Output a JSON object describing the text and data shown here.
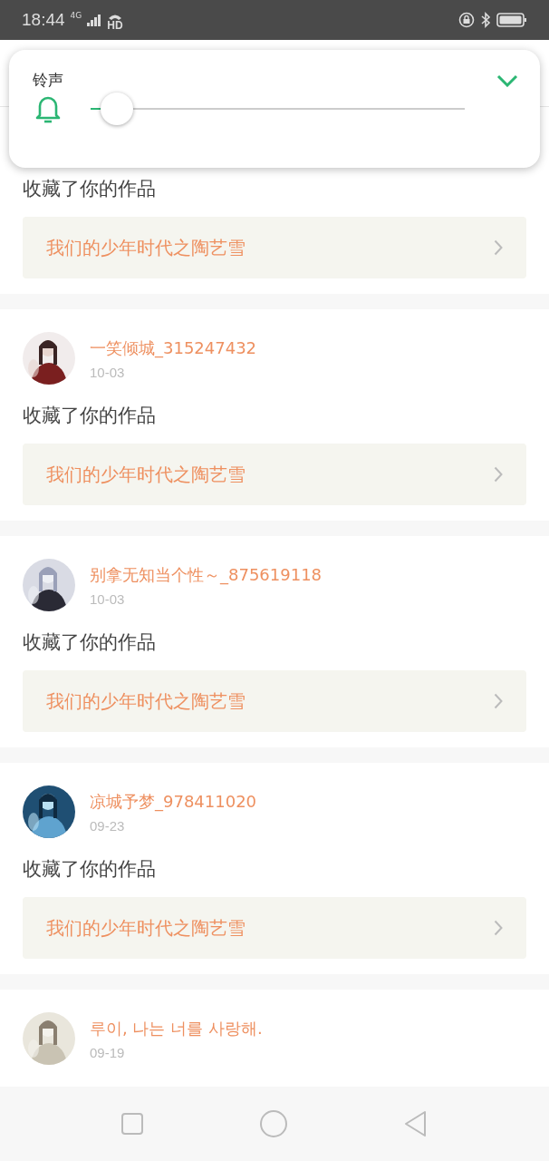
{
  "status_bar": {
    "time": "18:44",
    "network": "4G",
    "call_mark": "HD"
  },
  "volume_panel": {
    "label": "铃声",
    "level": 0.07
  },
  "notifications": [
    {
      "action": "收藏了你的作品",
      "work": "我们的少年时代之陶艺雪"
    },
    {
      "user": "一笑倾城_315247432",
      "date": "10-03",
      "action": "收藏了你的作品",
      "work": "我们的少年时代之陶艺雪"
    },
    {
      "user": "别拿无知当个性～_875619118",
      "date": "10-03",
      "action": "收藏了你的作品",
      "work": "我们的少年时代之陶艺雪"
    },
    {
      "user": "凉城予梦_978411020",
      "date": "09-23",
      "action": "收藏了你的作品",
      "work": "我们的少年时代之陶艺雪"
    },
    {
      "user": "루이, 나는 너를 사랑해.",
      "date": "09-19"
    }
  ]
}
